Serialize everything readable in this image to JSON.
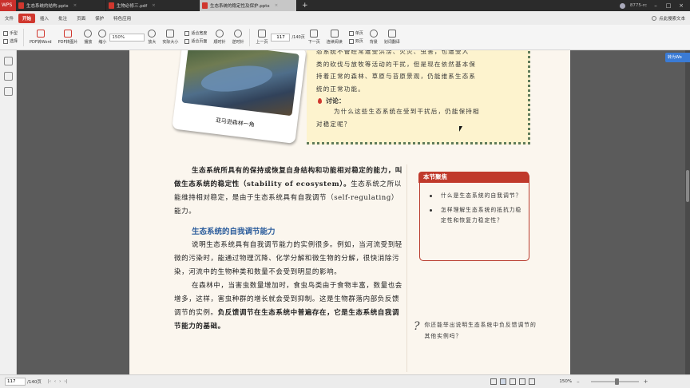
{
  "tabbar": {
    "app_name": "WPS",
    "tabs": [
      {
        "label": "生态系统的结构.pptx",
        "color": "#d0372e"
      },
      {
        "label": "生物必修三.pdf",
        "color": "#d0372e"
      },
      {
        "label": "生态系统的稳定性及保护.pptx",
        "color": "#d0372e"
      }
    ],
    "new_tab": "+",
    "user_label": "8775-rc"
  },
  "menubar": {
    "file": "文件",
    "items": [
      "开始",
      "插入",
      "批注",
      "页面",
      "保护",
      "特色应用"
    ],
    "search_label": "点此搜索文本"
  },
  "toolbar": {
    "hand": "手型",
    "select": "选择",
    "pdf_to_word": "PDF转Word",
    "pdf_to_image": "PDF转图片",
    "play": "播放",
    "zoom_out": "缩小",
    "zoom_value": "150%",
    "zoom_in": "放大",
    "actual_size": "实际大小",
    "fit_width": "适合宽度",
    "fit_page": "适合页面",
    "rotate_left": "顺时针",
    "rotate_right": "逆时针",
    "prev_page": "上一页",
    "page_value": "117",
    "page_total": "/140页",
    "next_page": "下一页",
    "continuous": "连续阅读",
    "single": "单页",
    "double": "双页",
    "background": "背景",
    "translate": "划词翻译"
  },
  "translate_badge": "转为Wo",
  "page": {
    "discussion_lines": [
      "态系统不管经常遭受洪涝、火灾、虫害，也遭受人",
      "类的砍伐与放牧等活动的干扰，但是现在依然基本保",
      "持着正常的森林、草原与苔原景观，仍能维系生态系",
      "统的正常功能。"
    ],
    "discussion_title": "讨论：",
    "discussion_question": [
      "为什么这些生态系统在受到干扰后，仍能保持相",
      "对稳定呢？"
    ],
    "photo_caption": "亚马逊森林一角",
    "para1": "生态系统所具有的保持或恢复自身结构和功能相对稳定的能力，叫做生态系统的稳定性（stability of ecosystem）。",
    "para1_rest": "生态系统之所以能维持相对稳定，是由于生态系统具有自我调节（self-regulating）能力。",
    "section_title": "生态系统的自我调节能力",
    "para2": "说明生态系统具有自我调节能力的实例很多。例如，当河流受到轻微的污染时，能通过物理沉降、化学分解和微生物的分解，很快消除污染，河流中的生物种类和数量不会受到明显的影响。",
    "para3": "在森林中，当害虫数量增加时，食虫鸟类由于食物丰富，数量也会增多，这样，害虫种群的增长就会受到抑制。这是生物群落内部负反馈调节的实例。",
    "para3_bold": "负反馈调节在生态系统中普遍存在，它是生态系统自我调节能力的基础。",
    "focus_title": "本节聚焦",
    "focus_items": [
      "什么是生态系统的自我调节？",
      "怎样理解生态系统的抵抗力稳定性和恢复力稳定性？"
    ],
    "think_mark": "?",
    "think_text": "你还能举出说明生态系统中负反馈调节的其他实例吗？"
  },
  "statusbar": {
    "page_value": "117",
    "page_total": "/140页",
    "zoom": "150%"
  }
}
